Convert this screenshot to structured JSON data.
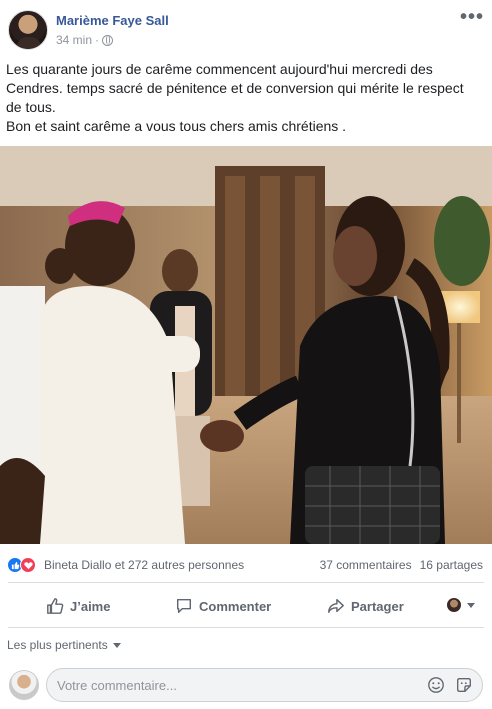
{
  "post": {
    "author": "Marième Faye Sall",
    "time": "34 min",
    "privacy_separator": "·",
    "privacy_icon": "globe-icon",
    "more_icon": "more-options-icon",
    "more_label": "•••",
    "text_line_1": "Les quarante jours de carême commencent aujourd'hui mercredi des Cendres. temps sacré de pénitence et de conversion qui mérite le respect de tous.",
    "text_line_2": "Bon et saint carême a vous tous chers amis chrétiens ."
  },
  "stats": {
    "reactions_text": "Bineta Diallo et 272 autres personnes",
    "comments": "37 commentaires",
    "shares": "16 partages",
    "reaction_icons": [
      "like-icon",
      "love-icon"
    ]
  },
  "actions": {
    "like": "J’aime",
    "comment": "Commenter",
    "share": "Partager"
  },
  "comments": {
    "sort_label": "Les plus pertinents",
    "input_placeholder": "Votre commentaire...",
    "emoji_icon": "emoji-icon",
    "sticker_icon": "sticker-icon"
  },
  "colors": {
    "author_link": "#385898",
    "secondary_text": "#606770",
    "like_blue": "#1877f2",
    "love_red": "#f33e58"
  }
}
